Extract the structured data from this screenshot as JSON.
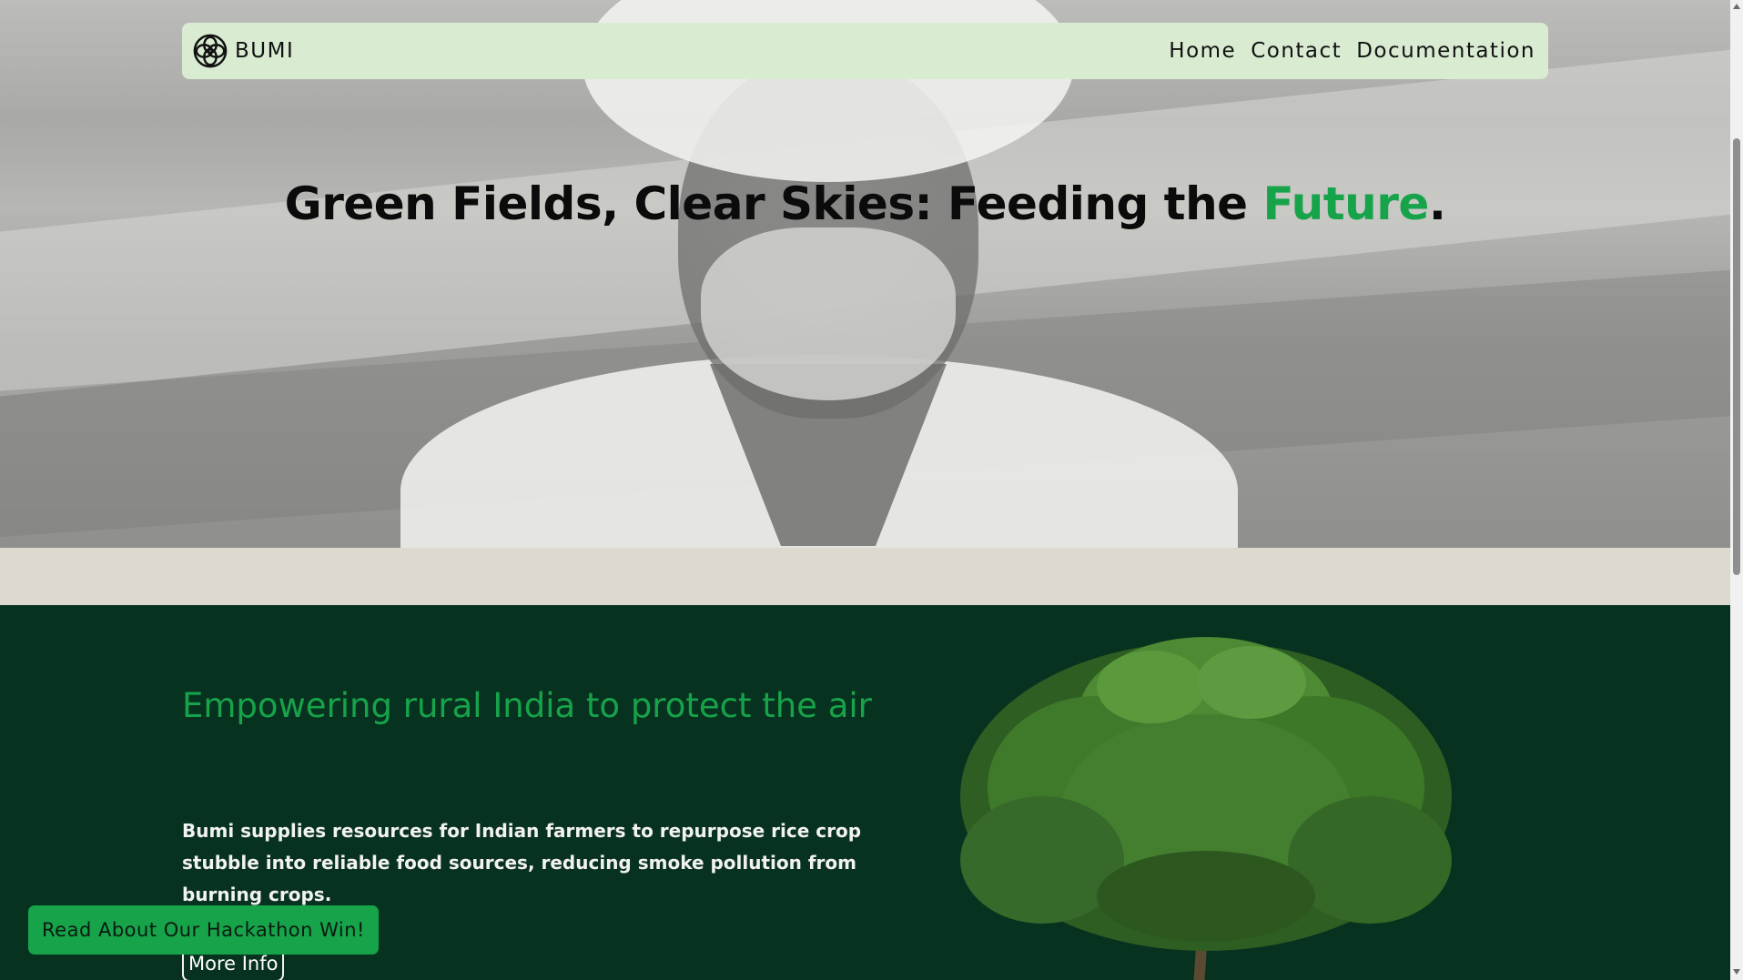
{
  "nav": {
    "brand": "BUMI",
    "links": [
      "Home",
      "Contact",
      "Documentation"
    ]
  },
  "hero": {
    "title_main": "Green Fields, Clear Skies: Feeding the ",
    "title_accent": "Future",
    "title_end": "."
  },
  "mission": {
    "heading": "Empowering rural India to protect the air",
    "body": "Bumi supplies resources for Indian farmers to repurpose rice crop stubble into reliable food sources, reducing smoke pollution from burning crops.",
    "more_info_label": "More Info"
  },
  "floating": {
    "hackathon_label": "Read About Our Hackathon Win!"
  },
  "colors": {
    "accent": "#16a34a",
    "navbar_bg": "#d9ecd2",
    "section_bg": "#083220",
    "strip_bg": "#ddd9cf"
  }
}
